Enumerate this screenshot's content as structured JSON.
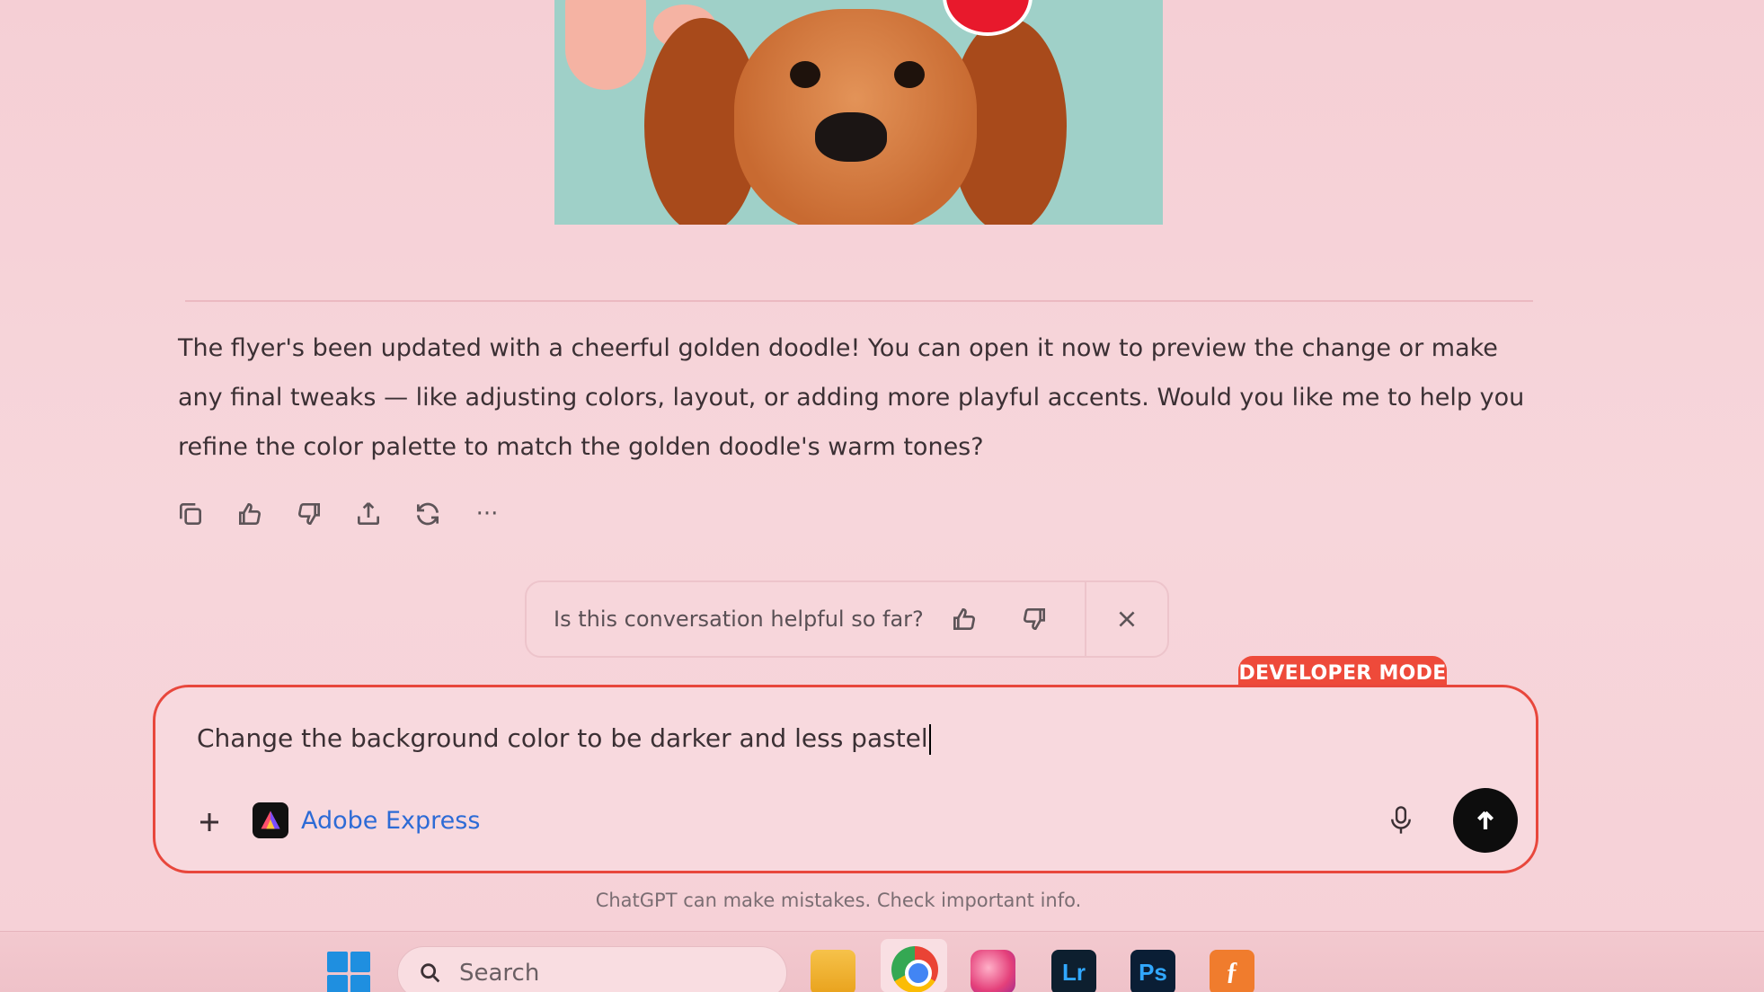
{
  "assistant_reply": {
    "text": "The flyer's been updated with a cheerful golden doodle! You can open it now to preview the change or make any final tweaks — like adjusting colors, layout, or adding more playful accents. Would you like me to help you refine the color palette to match the golden doodle's warm tones?"
  },
  "message_actions": [
    {
      "icon": "copy-icon"
    },
    {
      "icon": "thumbs-up-icon"
    },
    {
      "icon": "thumbs-down-icon"
    },
    {
      "icon": "share-icon"
    },
    {
      "icon": "regenerate-icon"
    },
    {
      "icon": "more-icon",
      "glyph": "···"
    }
  ],
  "feedback_prompt": {
    "question": "Is this conversation helpful so far?"
  },
  "composer": {
    "badge": "DEVELOPER MODE",
    "input_value": "Change the background color to be darker and less pastel",
    "tool_name": "Adobe Express"
  },
  "disclaimer": "ChatGPT can make mistakes. Check important info.",
  "taskbar": {
    "search_placeholder": "Search",
    "apps": [
      {
        "name": "file-explorer"
      },
      {
        "name": "chrome"
      },
      {
        "name": "creative-cloud"
      },
      {
        "name": "lightroom",
        "label": "Lr"
      },
      {
        "name": "photoshop",
        "label": "Ps"
      },
      {
        "name": "figma-like-app",
        "label": "ƒ"
      }
    ]
  },
  "colors": {
    "background": "#f6d3d8",
    "accent_red": "#ee4a3a",
    "link_blue": "#2d6bd6",
    "send_button": "#0d0d0d"
  }
}
